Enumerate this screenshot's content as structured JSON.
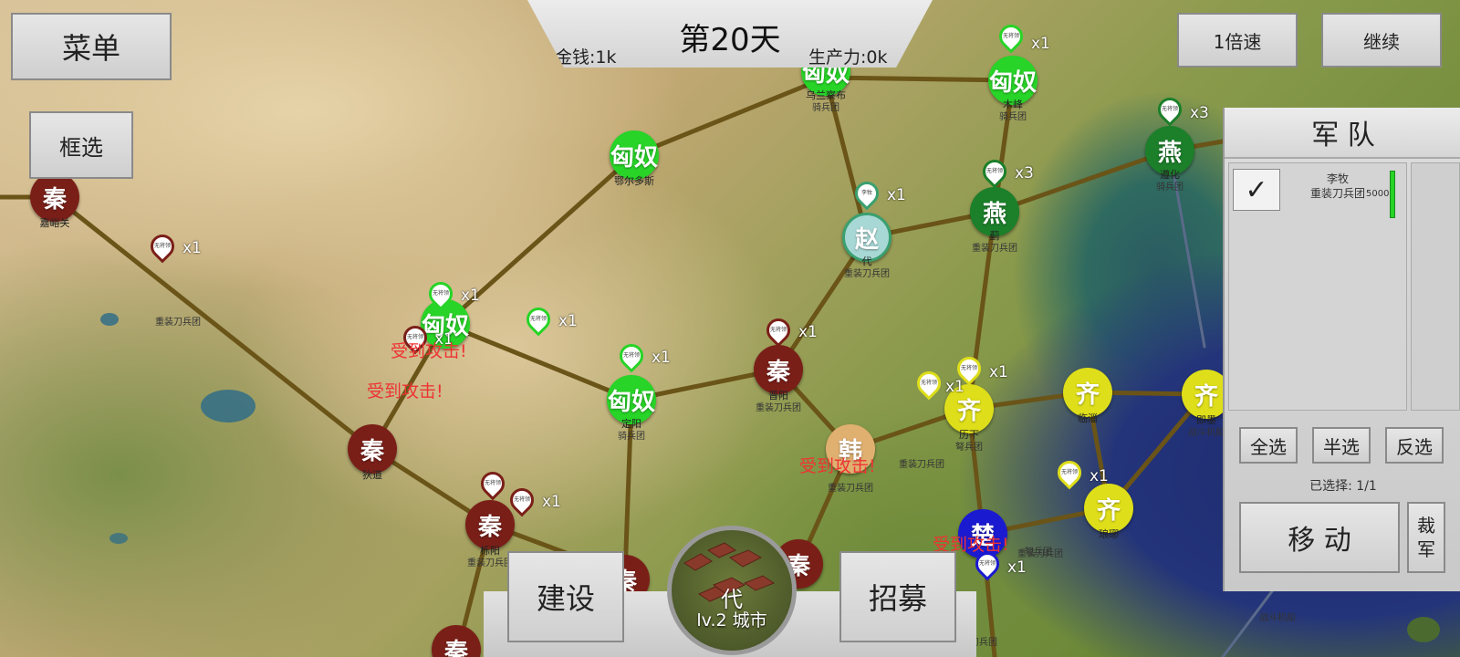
{
  "hud": {
    "menu_label": "菜单",
    "box_select_label": "框选",
    "day_label": "第20天",
    "money_label": "金钱:1k",
    "production_label": "生产力:0k",
    "speed_label": "1倍速",
    "continue_label": "继续"
  },
  "army_panel": {
    "title": "军 队",
    "unit": {
      "general": "李牧",
      "type": "重装刀兵团",
      "strength": "5000",
      "checked": true
    },
    "select_all": "全选",
    "select_half": "半选",
    "select_invert": "反选",
    "selected_label": "已选择: 1/1",
    "move_label": "移 动",
    "disband_label": "裁 军"
  },
  "bottom": {
    "build_label": "建设",
    "recruit_label": "招募",
    "city_name": "代",
    "city_level": "lv.2 城市"
  },
  "colors": {
    "qin": "#7a1f18",
    "xiongnu": "#27d427",
    "yan": "#1c7f2a",
    "qi": "#dede1a",
    "chu": "#1a1ad0",
    "zhao": "#a8d8d6",
    "road": "#6a5418",
    "attack_text": "#e33333"
  },
  "cities": [
    {
      "id": "jiayuguan",
      "faction": "秦",
      "class": "qin",
      "name": "嘉峪关"
    },
    {
      "id": "ordos",
      "faction": "匈奴",
      "class": "hun",
      "name": "鄂尔多斯"
    },
    {
      "id": "wulanchabu",
      "faction": "匈奴",
      "class": "hun",
      "name": "乌兰察布",
      "unit": "骑兵团"
    },
    {
      "id": "muye",
      "faction": "匈奴",
      "class": "hun",
      "name": "木峰",
      "unit": "骑兵团"
    },
    {
      "id": "yan_north",
      "faction": "燕",
      "class": "yan",
      "name": "遵化",
      "unit": "骑兵团"
    },
    {
      "id": "zhao_dai",
      "faction": "赵",
      "class": "zhao",
      "name": "代",
      "unit": "重装刀兵团"
    },
    {
      "id": "yan_ji",
      "faction": "燕",
      "class": "yan",
      "name": "蓟",
      "unit": "重装刀兵团"
    },
    {
      "id": "hun_west",
      "faction": "匈奴",
      "class": "hun",
      "name": ""
    },
    {
      "id": "hun_dingyang",
      "faction": "匈奴",
      "class": "hun",
      "name": "定阳",
      "unit": "骑兵团"
    },
    {
      "id": "qin_jinyang",
      "faction": "秦",
      "class": "qin",
      "name": "晋阳",
      "unit": "重装刀兵团"
    },
    {
      "id": "qi_lixia",
      "faction": "齐",
      "class": "qi",
      "name": "历下",
      "unit": "弩兵团"
    },
    {
      "id": "qi_linzi",
      "faction": "齐",
      "class": "qi",
      "name": "临淄"
    },
    {
      "id": "qi_jimo",
      "faction": "齐",
      "class": "qi",
      "name": "即墨",
      "unit": "战斗机船"
    },
    {
      "id": "qin_didao",
      "faction": "秦",
      "class": "qin",
      "name": "狄道"
    },
    {
      "id": "han_city",
      "faction": "韩",
      "class": "dai",
      "name": "",
      "unit": "重装刀兵团"
    },
    {
      "id": "qin_south",
      "faction": "秦",
      "class": "qin",
      "name": "栎阳",
      "unit": "重装刀兵团"
    },
    {
      "id": "qi_langya",
      "faction": "齐",
      "class": "qi",
      "name": "琅琊"
    },
    {
      "id": "chu_city",
      "faction": "楚",
      "class": "chu",
      "name": "",
      "unit": "重装刀兵团"
    },
    {
      "id": "qin_sw",
      "faction": "秦",
      "class": "qin",
      "name": ""
    },
    {
      "id": "qin_far_sw",
      "faction": "秦",
      "class": "qin",
      "name": ""
    },
    {
      "id": "qin_se",
      "faction": "秦",
      "class": "qin",
      "name": ""
    }
  ],
  "pins": [
    {
      "id": "p1",
      "label": "无将领",
      "count": "x1",
      "color": "#7a1f18"
    },
    {
      "id": "p2",
      "label": "无将领",
      "count": "x1",
      "color": "#27d427"
    },
    {
      "id": "p3",
      "label": "无将领",
      "count": "x1",
      "color": "#7a1f18"
    },
    {
      "id": "p4",
      "label": "无将领",
      "count": "x1",
      "color": "#27d427"
    },
    {
      "id": "p5",
      "label": "无将领",
      "count": "x1",
      "color": "#27d427"
    },
    {
      "id": "p6",
      "label": "无将领",
      "count": "x1",
      "color": "#7a1f18"
    },
    {
      "id": "p7",
      "label": "李牧",
      "count": "x1",
      "color": "#3aa070"
    },
    {
      "id": "p8",
      "label": "无将领",
      "count": "x1",
      "color": "#27d427"
    },
    {
      "id": "p9",
      "label": "无将领",
      "count": "x3",
      "color": "#1c7f2a"
    },
    {
      "id": "p10",
      "label": "无将领",
      "count": "x3",
      "color": "#1c7f2a"
    },
    {
      "id": "p11",
      "label": "无将领",
      "count": "x1",
      "color": "#dede1a"
    },
    {
      "id": "p12",
      "label": "无将领",
      "count": "x1",
      "color": "#dede1a"
    },
    {
      "id": "p13",
      "label": "无将领",
      "count": "x1",
      "color": "#7a1f18"
    },
    {
      "id": "p14",
      "label": "无将领",
      "count": "x1",
      "color": "#7a1f18"
    },
    {
      "id": "p15",
      "label": "无将领",
      "count": "x1",
      "color": "#dede1a"
    },
    {
      "id": "p16",
      "label": "无将领",
      "count": "x1",
      "color": "#1a1ad0"
    }
  ],
  "attack_labels": [
    "受到攻击!",
    "受到攻击!",
    "受到攻击!",
    "受到攻击!"
  ],
  "misc_labels": [
    "重装刀兵团",
    "弩兵团",
    "骑兵团",
    "重装刀兵团",
    "重装刀兵团",
    "战斗机船"
  ]
}
